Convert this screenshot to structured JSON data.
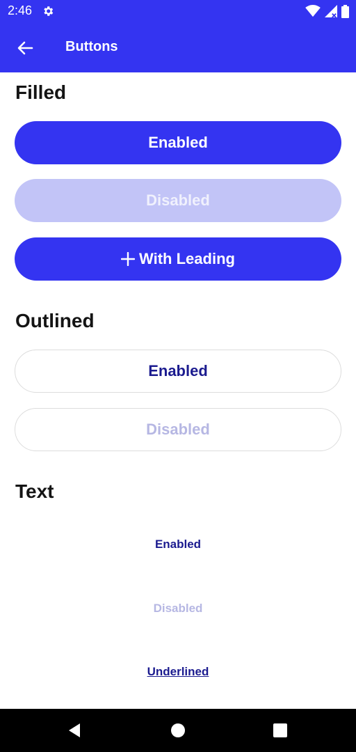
{
  "status_bar": {
    "time": "2:46"
  },
  "app_bar": {
    "title": "Buttons"
  },
  "sections": {
    "filled": {
      "title": "Filled",
      "enabled_label": "Enabled",
      "disabled_label": "Disabled",
      "leading_label": "With Leading",
      "leading_icon": "plus-icon"
    },
    "outlined": {
      "title": "Outlined",
      "enabled_label": "Enabled",
      "disabled_label": "Disabled"
    },
    "text": {
      "title": "Text",
      "enabled_label": "Enabled",
      "disabled_label": "Disabled",
      "underlined_label": "Underlined"
    }
  },
  "colors": {
    "primary": "#3434f1",
    "primary_disabled": "#c2c4f7",
    "text_enabled": "#1b1b8f",
    "text_disabled": "#b6b7e3"
  }
}
